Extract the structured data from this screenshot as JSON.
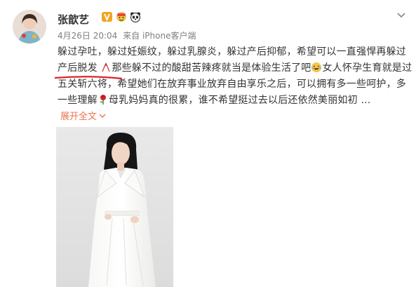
{
  "user": {
    "name": "张歆艺",
    "badges": [
      "vip-v-icon",
      "emoji-badge-icon",
      "panda-icon"
    ]
  },
  "meta": {
    "date": "4月26日 20:04",
    "source": "来自 iPhone客户端"
  },
  "post": {
    "line1": "躲过孕吐，躲过妊娠纹，躲过乳腺炎，躲过产后抑郁，希望可以一直强悍再躲过",
    "line2_underlined": "产后脱发",
    "line2_rest_a": "那些躲不过的酸甜苦辣疼就当是体验生活了吧",
    "line2_rest_b": "女人怀孕生育就是过",
    "line3": "五关斩六将，希望她们在放弃事业放弃自由享乐之后，可以拥有多一些呵护，多",
    "line4_a": "一些理解",
    "line4_b": "母乳妈妈真的很累，谁不希望挺过去以后还依然美丽如初 ..."
  },
  "expand_label": "展开全文",
  "colors": {
    "link": "#eb7350",
    "annotation": "#d9262b",
    "text": "#333333",
    "meta": "#808080"
  }
}
